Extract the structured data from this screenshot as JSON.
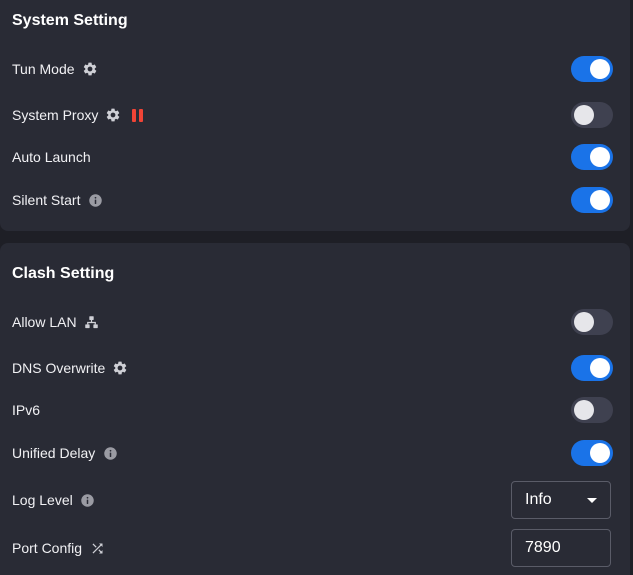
{
  "system_setting": {
    "title": "System Setting",
    "tun_mode": {
      "label": "Tun Mode",
      "icon": "gear-icon",
      "enabled": true
    },
    "system_proxy": {
      "label": "System Proxy",
      "icon": "gear-icon",
      "status_icon": "pause-icon",
      "status_color": "#f04436",
      "enabled": false
    },
    "auto_launch": {
      "label": "Auto Launch",
      "enabled": true
    },
    "silent_start": {
      "label": "Silent Start",
      "icon": "info-icon",
      "enabled": true
    }
  },
  "clash_setting": {
    "title": "Clash Setting",
    "allow_lan": {
      "label": "Allow LAN",
      "icon": "network-icon",
      "enabled": false
    },
    "dns_overwrite": {
      "label": "DNS Overwrite",
      "icon": "gear-icon",
      "enabled": true
    },
    "ipv6": {
      "label": "IPv6",
      "enabled": false
    },
    "unified_delay": {
      "label": "Unified Delay",
      "icon": "info-icon",
      "enabled": true
    },
    "log_level": {
      "label": "Log Level",
      "icon": "info-icon",
      "value": "Info"
    },
    "port_config": {
      "label": "Port Config",
      "icon": "shuffle-icon",
      "value": "7890"
    }
  },
  "colors": {
    "accent": "#1a73e8",
    "background": "#1e1f26",
    "panel": "#292b35",
    "toggle_off": "#3f4150"
  }
}
